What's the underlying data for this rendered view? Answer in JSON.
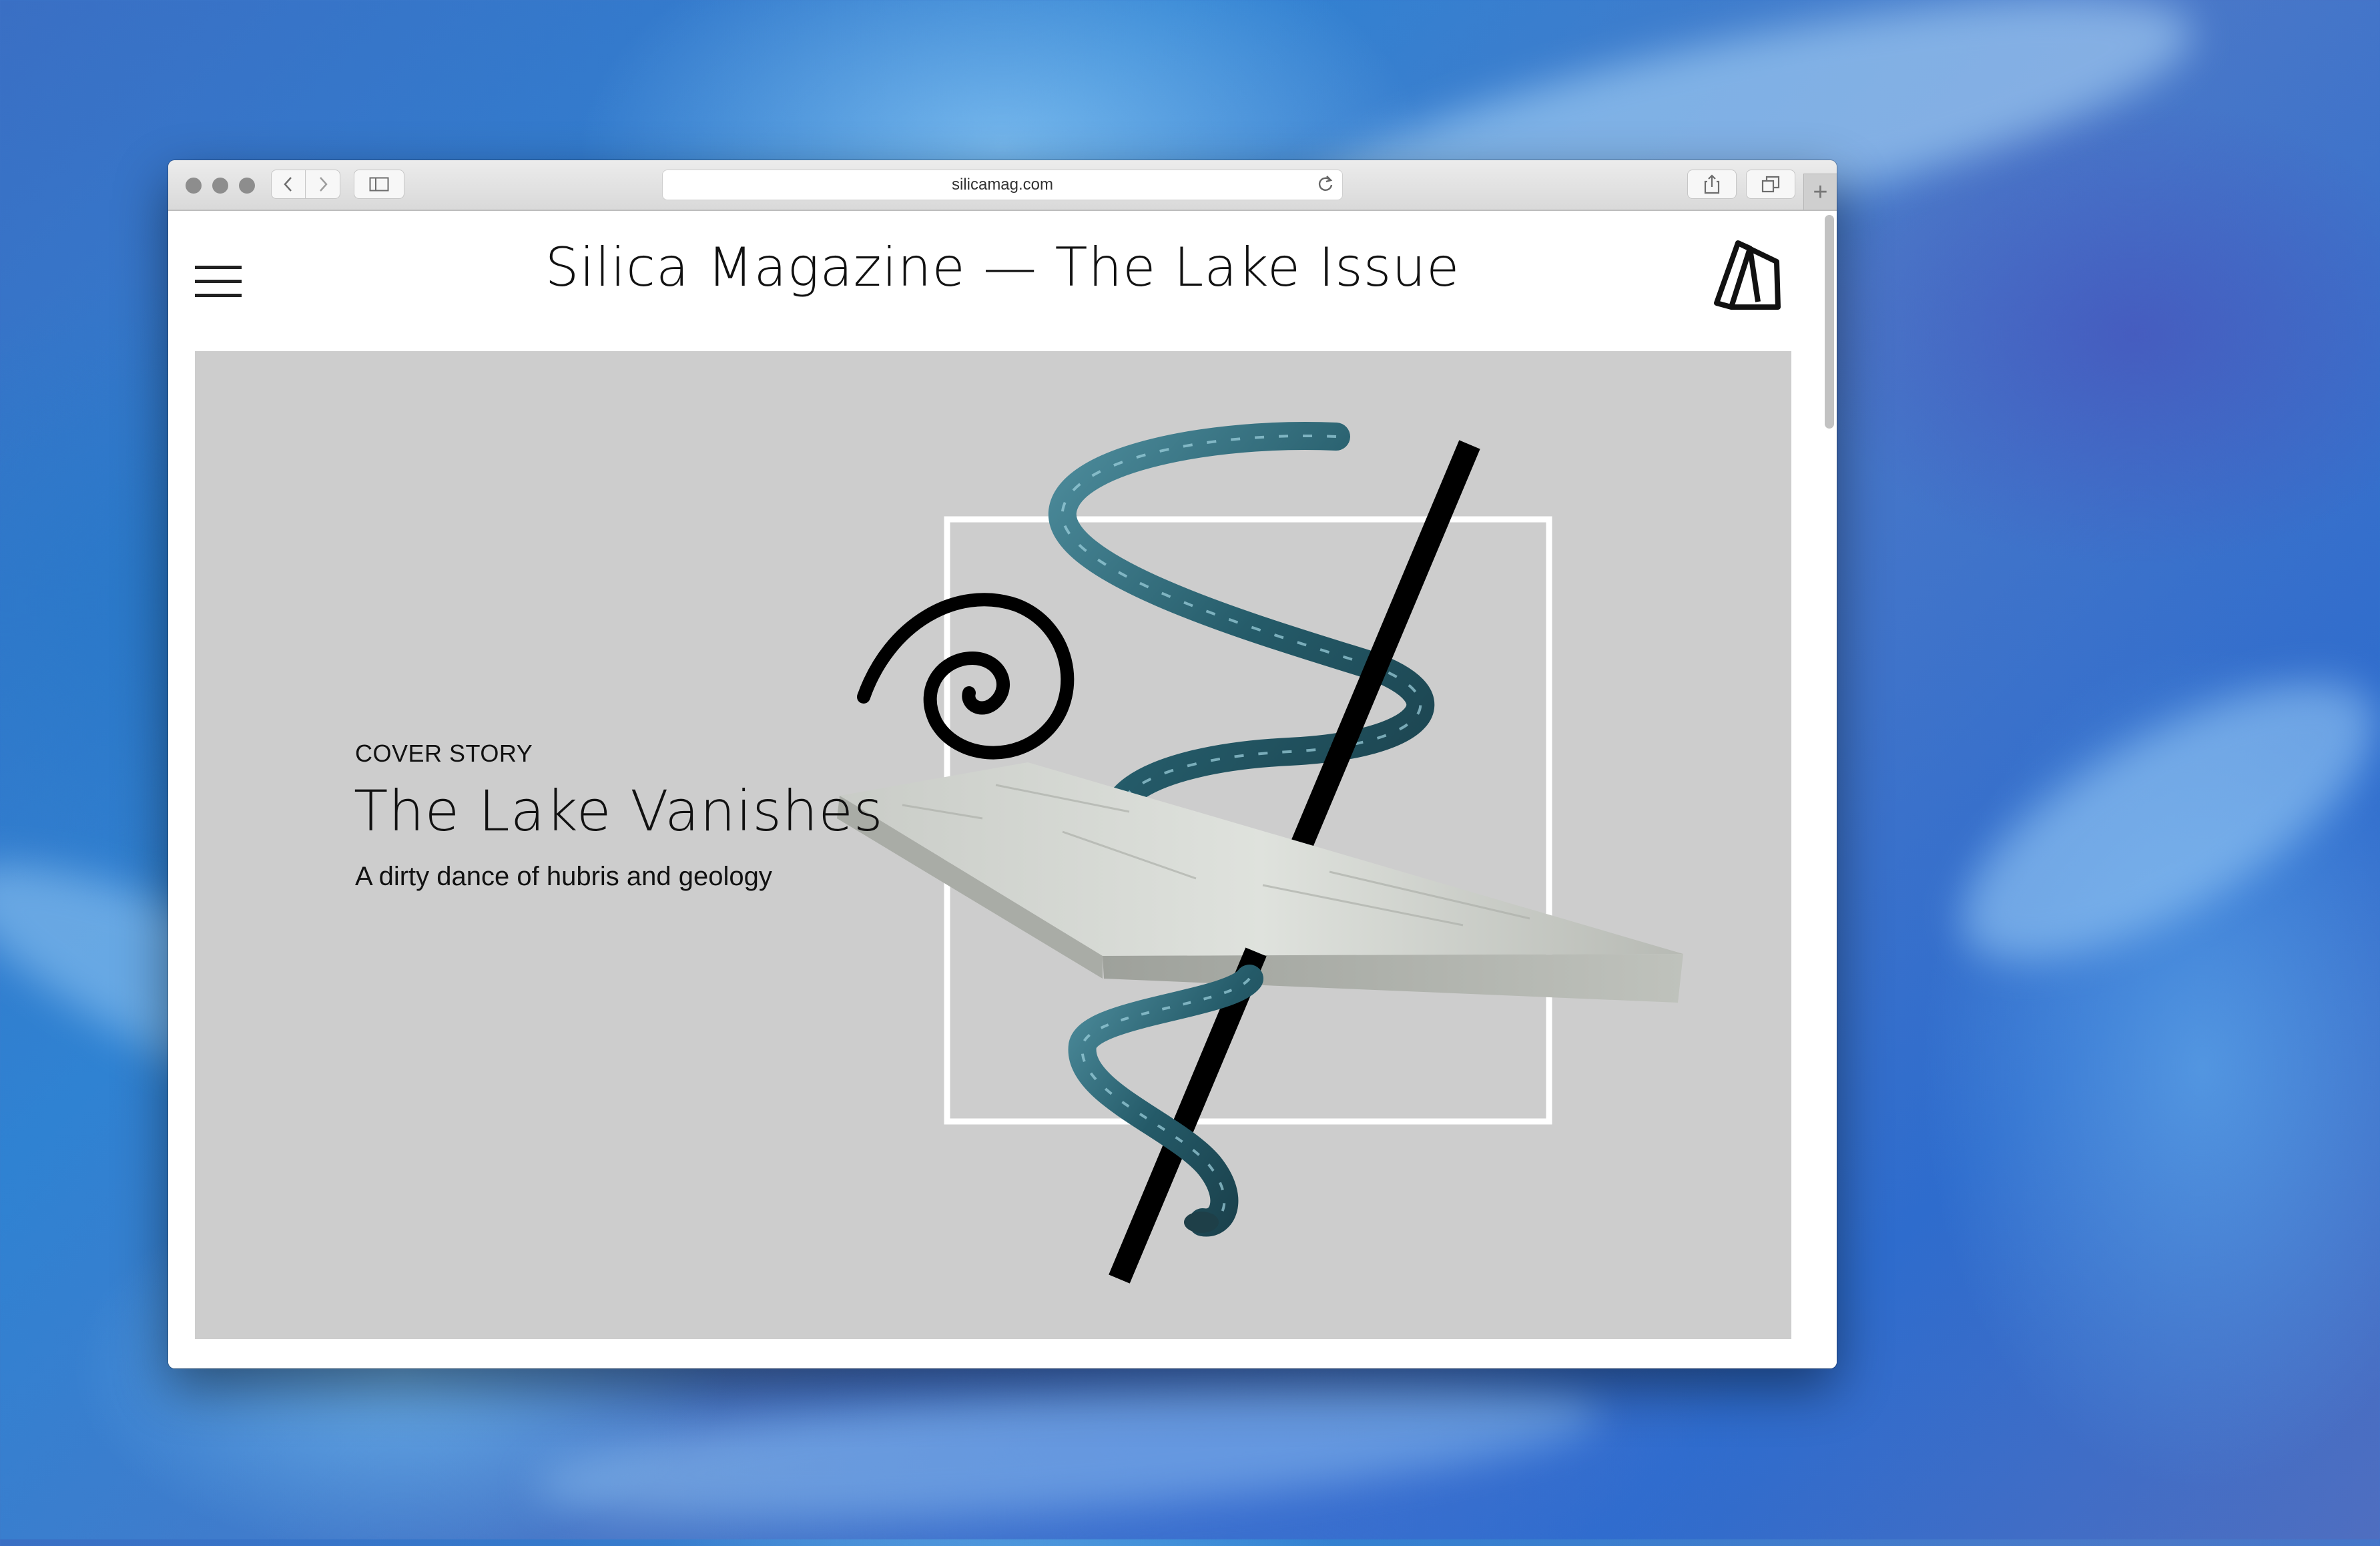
{
  "browser": {
    "url": "silicamag.com"
  },
  "site": {
    "title": "Silica Magazine — The Lake Issue"
  },
  "hero": {
    "kicker": "COVER STORY",
    "headline": "The Lake Vanishes",
    "dek": "A dirty dance of hubris and geology"
  },
  "colors": {
    "hero_background": "#cdcdcd",
    "helix": "#2f6b7a",
    "ink": "#111111"
  },
  "icons": [
    "hamburger-menu-icon",
    "silica-logo-icon",
    "back-icon",
    "forward-icon",
    "sidebar-icon",
    "reload-icon",
    "share-icon",
    "tabs-icon",
    "new-tab-icon"
  ]
}
